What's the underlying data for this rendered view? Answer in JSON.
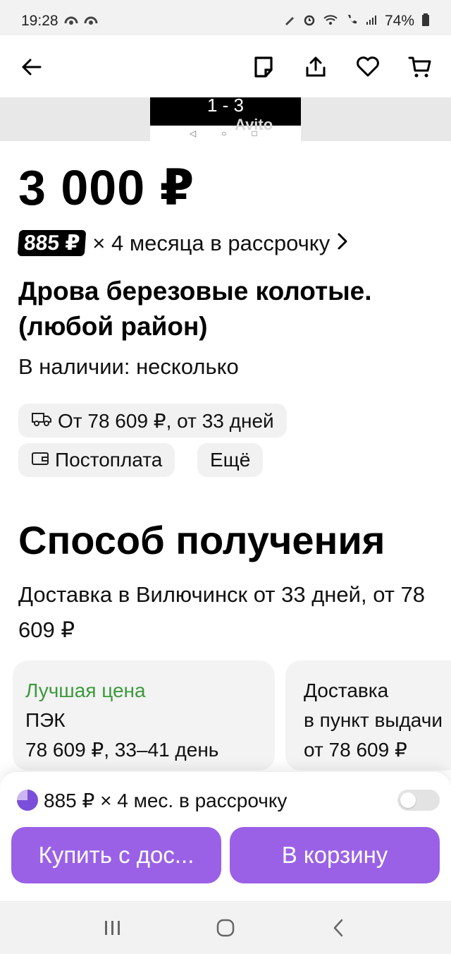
{
  "status_bar": {
    "time": "19:28",
    "battery": "74%"
  },
  "gallery": {
    "counter": "1 - 3",
    "watermark": "Avito"
  },
  "product": {
    "price": "3 000 ₽",
    "installment_badge": "885 ₽",
    "installment_text": "× 4 месяца в рассрочку",
    "title": "Дрова березовые колотые. (любой район)",
    "stock": "В наличии: несколько"
  },
  "chips": {
    "delivery": "От 78 609 ₽, от 33 дней",
    "postpay": "Постоплата",
    "more": "Ещё"
  },
  "delivery_section": {
    "title": "Способ получения",
    "subtitle": "Доставка в Вилючинск от 33 дней, от 78 609 ₽"
  },
  "cards": [
    {
      "tag": "Лучшая цена",
      "line1": "ПЭК",
      "line2": "78 609 ₽, 33–41 день"
    },
    {
      "line1": "Доставка",
      "line2": "в пункт выдачи",
      "line3": "от 78 609 ₽"
    }
  ],
  "bottom_panel": {
    "installment": "885 ₽ × 4 мес. в рассрочку",
    "installment_enabled": false,
    "buy_button": "Купить с дос...",
    "cart_button": "В корзину"
  },
  "colors": {
    "accent": "#9a61e6",
    "green": "#3c9a3c"
  }
}
